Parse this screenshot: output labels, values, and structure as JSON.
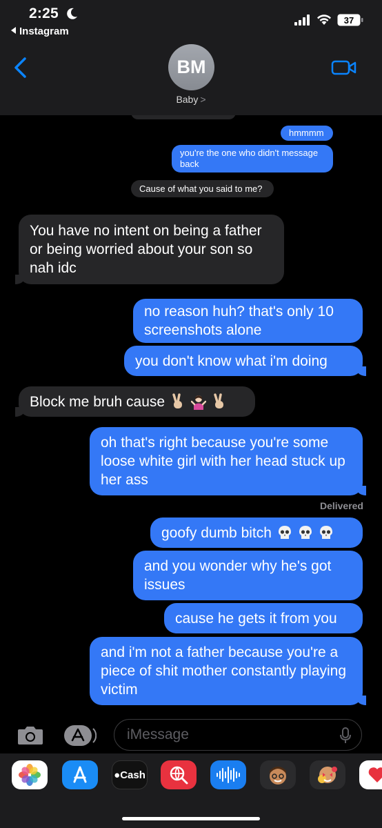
{
  "status_bar": {
    "time": "2:25",
    "back_app": "Instagram",
    "battery": "37"
  },
  "header": {
    "avatar_initials": "BM",
    "contact_name": "Baby",
    "name_chevron": ">"
  },
  "messages": [
    {
      "dir": "out",
      "text": "hmmmm"
    },
    {
      "dir": "out",
      "text": "you're the one who didn't message back"
    },
    {
      "dir": "in",
      "text": "Cause of what you said to me?"
    },
    {
      "dir": "in",
      "text": "You have no intent on being a father or being worried about your son so nah idc"
    },
    {
      "dir": "out",
      "text": "no reason huh? that's only 10 screenshots alone"
    },
    {
      "dir": "out",
      "text": "you don't know what i'm doing"
    },
    {
      "dir": "in",
      "text": "Block me bruh cause"
    },
    {
      "dir": "out",
      "text": "oh that's right because you're some loose white girl with her head stuck up her ass"
    },
    {
      "dir": "out",
      "text": "goofy dumb bitch"
    },
    {
      "dir": "out",
      "text": "and you wonder why he's got issues"
    },
    {
      "dir": "out",
      "text": "cause he gets it from you"
    },
    {
      "dir": "out",
      "text": "and i'm not a father because you're a piece of shit mother constantly playing victim"
    }
  ],
  "delivered_label": "Delivered",
  "input": {
    "placeholder": "iMessage"
  },
  "drawer": {
    "cash_label": "Cash"
  },
  "colors": {
    "outgoing_bubble": "#3478f6",
    "incoming_bubble": "#262628",
    "header_bg": "#1c1c1e",
    "accent": "#0a84ff"
  },
  "icons": [
    "moon-icon",
    "signal-icon",
    "wifi-icon",
    "battery-icon",
    "back-chevron-icon",
    "video-call-icon",
    "camera-icon",
    "app-store-icon",
    "microphone-icon",
    "photos-app-icon",
    "app-store-app-icon",
    "apple-cash-app-icon",
    "image-search-app-icon",
    "audio-message-app-icon",
    "memoji-app-icon",
    "memoji-stickers-app-icon",
    "digital-touch-app-icon"
  ]
}
